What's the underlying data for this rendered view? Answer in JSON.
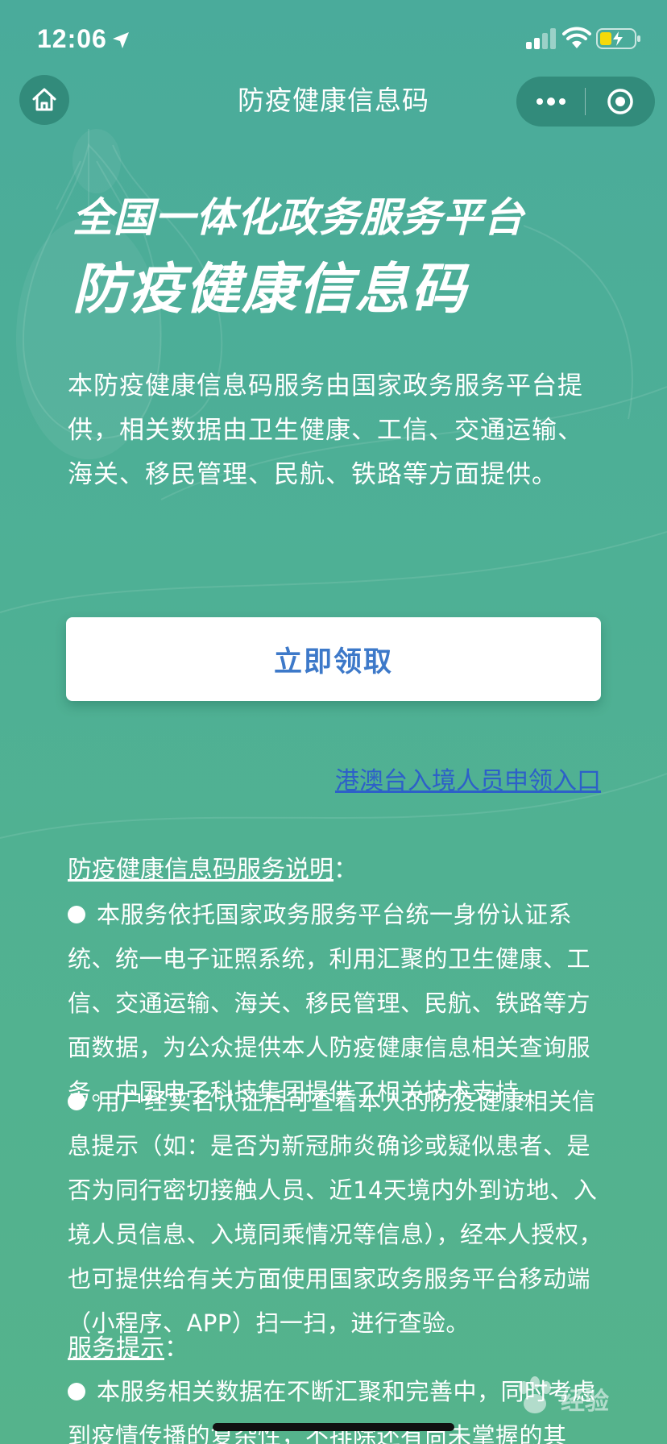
{
  "status_bar": {
    "time": "12:06"
  },
  "nav": {
    "title": "防疫健康信息码"
  },
  "hero": {
    "line1": "全国一体化政务服务平台",
    "line2": "防疫健康信息码"
  },
  "intro": "本防疫健康信息码服务由国家政务服务平台提供，相关数据由卫生健康、工信、交通运输、海关、移民管理、民航、铁路等方面提供。",
  "claim_button_label": "立即领取",
  "hmt_link_label": "港澳台入境人员申领入口",
  "explanation": {
    "heading": "防疫健康信息码服务说明",
    "heading_suffix": "：",
    "items": [
      "本服务依托国家政务服务平台统一身份认证系统、统一电子证照系统，利用汇聚的卫生健康、工信、交通运输、海关、移民管理、民航、铁路等方面数据，为公众提供本人防疫健康信息相关查询服务。中国电子科技集团提供了相关技术支持。",
      "用户经实名认证后可查看本人的防疫健康相关信息提示（如：是否为新冠肺炎确诊或疑似患者、是否为同行密切接触人员、近14天境内外到访地、入境人员信息、入境同乘情况等信息），经本人授权，也可提供给有关方面使用国家政务服务平台移动端（小程序、APP）扫一扫，进行查验。"
    ]
  },
  "tips": {
    "heading": "服务提示",
    "heading_suffix": "：",
    "items": [
      "本服务相关数据在不断汇聚和完善中，同时考虑到疫情传播的复杂性，不排除还有尚未掌握的其"
    ]
  },
  "watermark": {
    "text": "经验"
  },
  "colors": {
    "background_top": "#4aab9b",
    "background_bottom": "#55b38c",
    "button_text": "#3d79c9",
    "link": "#2d60c8"
  },
  "icons": {
    "home": "home-icon",
    "more": "more-dots-icon",
    "close": "target-circle-icon",
    "location": "location-arrow-icon",
    "signal": "cellular-signal-icon",
    "wifi": "wifi-icon",
    "battery": "battery-charging-icon"
  }
}
